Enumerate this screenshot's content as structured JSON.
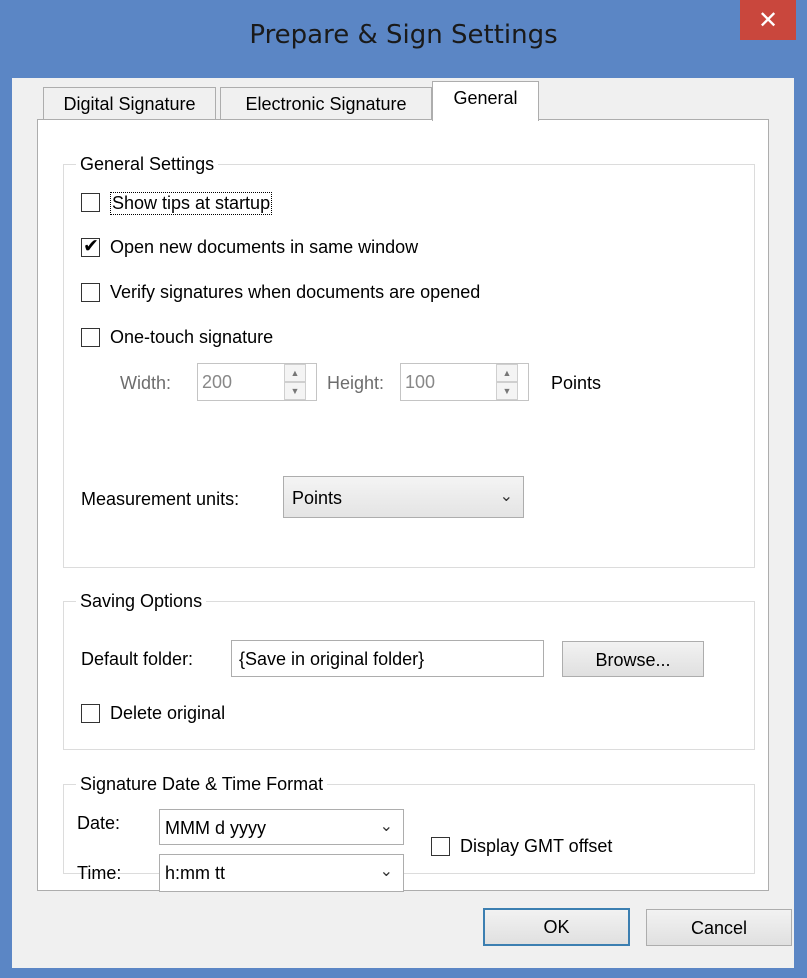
{
  "window": {
    "title": "Prepare & Sign Settings",
    "close_glyph": "✕"
  },
  "tabs": [
    {
      "label": "Digital Signature",
      "active": false
    },
    {
      "label": "Electronic Signature",
      "active": false
    },
    {
      "label": "General",
      "active": true
    }
  ],
  "general_settings": {
    "legend": "General Settings",
    "show_tips": {
      "label": "Show tips at startup",
      "checked": false
    },
    "open_same_window": {
      "label": "Open new documents in same window",
      "checked": true
    },
    "verify_signatures": {
      "label": "Verify signatures when documents are opened",
      "checked": false
    },
    "one_touch": {
      "label": "One-touch signature",
      "checked": false
    },
    "width_label": "Width:",
    "width_value": "200",
    "height_label": "Height:",
    "height_value": "100",
    "size_units": "Points",
    "measurement_label": "Measurement units:",
    "measurement_value": "Points"
  },
  "saving_options": {
    "legend": "Saving Options",
    "folder_label": "Default folder:",
    "folder_value": "{Save in original folder}",
    "browse_label": "Browse...",
    "delete_original": {
      "label": "Delete original",
      "checked": false
    }
  },
  "date_time": {
    "legend": "Signature Date & Time Format",
    "date_label": "Date:",
    "date_value": "MMM d yyyy",
    "time_label": "Time:",
    "time_value": "h:mm tt",
    "gmt": {
      "label": "Display GMT offset",
      "checked": false
    }
  },
  "footer": {
    "ok_label": "OK",
    "cancel_label": "Cancel"
  },
  "icons": {
    "check": "✔",
    "chevron": "⌄",
    "spin_up": "▲",
    "spin_down": "▼"
  },
  "colors": {
    "title_bar": "#5b86c5",
    "close_button": "#c9473d",
    "default_button_border": "#3c7fb1"
  }
}
